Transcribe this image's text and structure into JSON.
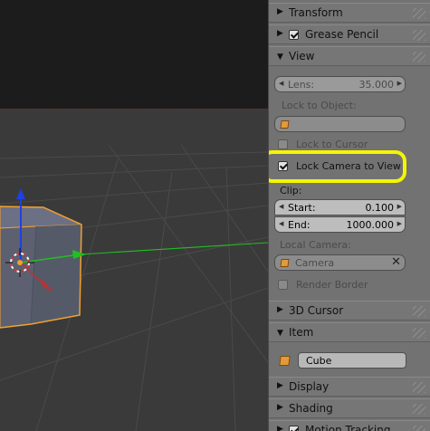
{
  "panel": {
    "sections": {
      "transform": {
        "label": "Transform"
      },
      "grease_pencil": {
        "label": "Grease Pencil",
        "checked": true
      },
      "view": {
        "label": "View"
      },
      "cursor_3d": {
        "label": "3D Cursor"
      },
      "item": {
        "label": "Item"
      },
      "display": {
        "label": "Display"
      },
      "shading": {
        "label": "Shading"
      },
      "motion_tracking": {
        "label": "Motion Tracking",
        "checked": true
      }
    },
    "view": {
      "lens_label": "Lens:",
      "lens_value": "35.000",
      "lock_to_object_label": "Lock to Object:",
      "lock_to_cursor_label": "Lock to Cursor",
      "lock_to_cursor_checked": false,
      "lock_camera_label": "Lock Camera to View",
      "lock_camera_checked": true,
      "clip_label": "Clip:",
      "clip_start_label": "Start:",
      "clip_start_value": "0.100",
      "clip_end_label": "End:",
      "clip_end_value": "1000.000",
      "local_camera_label": "Local Camera:",
      "local_camera_value": "Camera",
      "render_border_label": "Render Border",
      "render_border_checked": false
    },
    "item": {
      "name": "Cube"
    }
  },
  "colors": {
    "highlight": "#f5f500",
    "selection_outline": "#f0a030",
    "axis_x": "#c03030",
    "axis_y": "#20c020",
    "axis_z": "#2040e0",
    "camera_frame": "#8a2020"
  },
  "icons": [
    "disclosure-triangle-icon",
    "checkbox-icon",
    "cube-object-icon",
    "camera-object-icon",
    "clear-x-icon",
    "3d-cursor-icon",
    "translate-arrow-icon"
  ]
}
